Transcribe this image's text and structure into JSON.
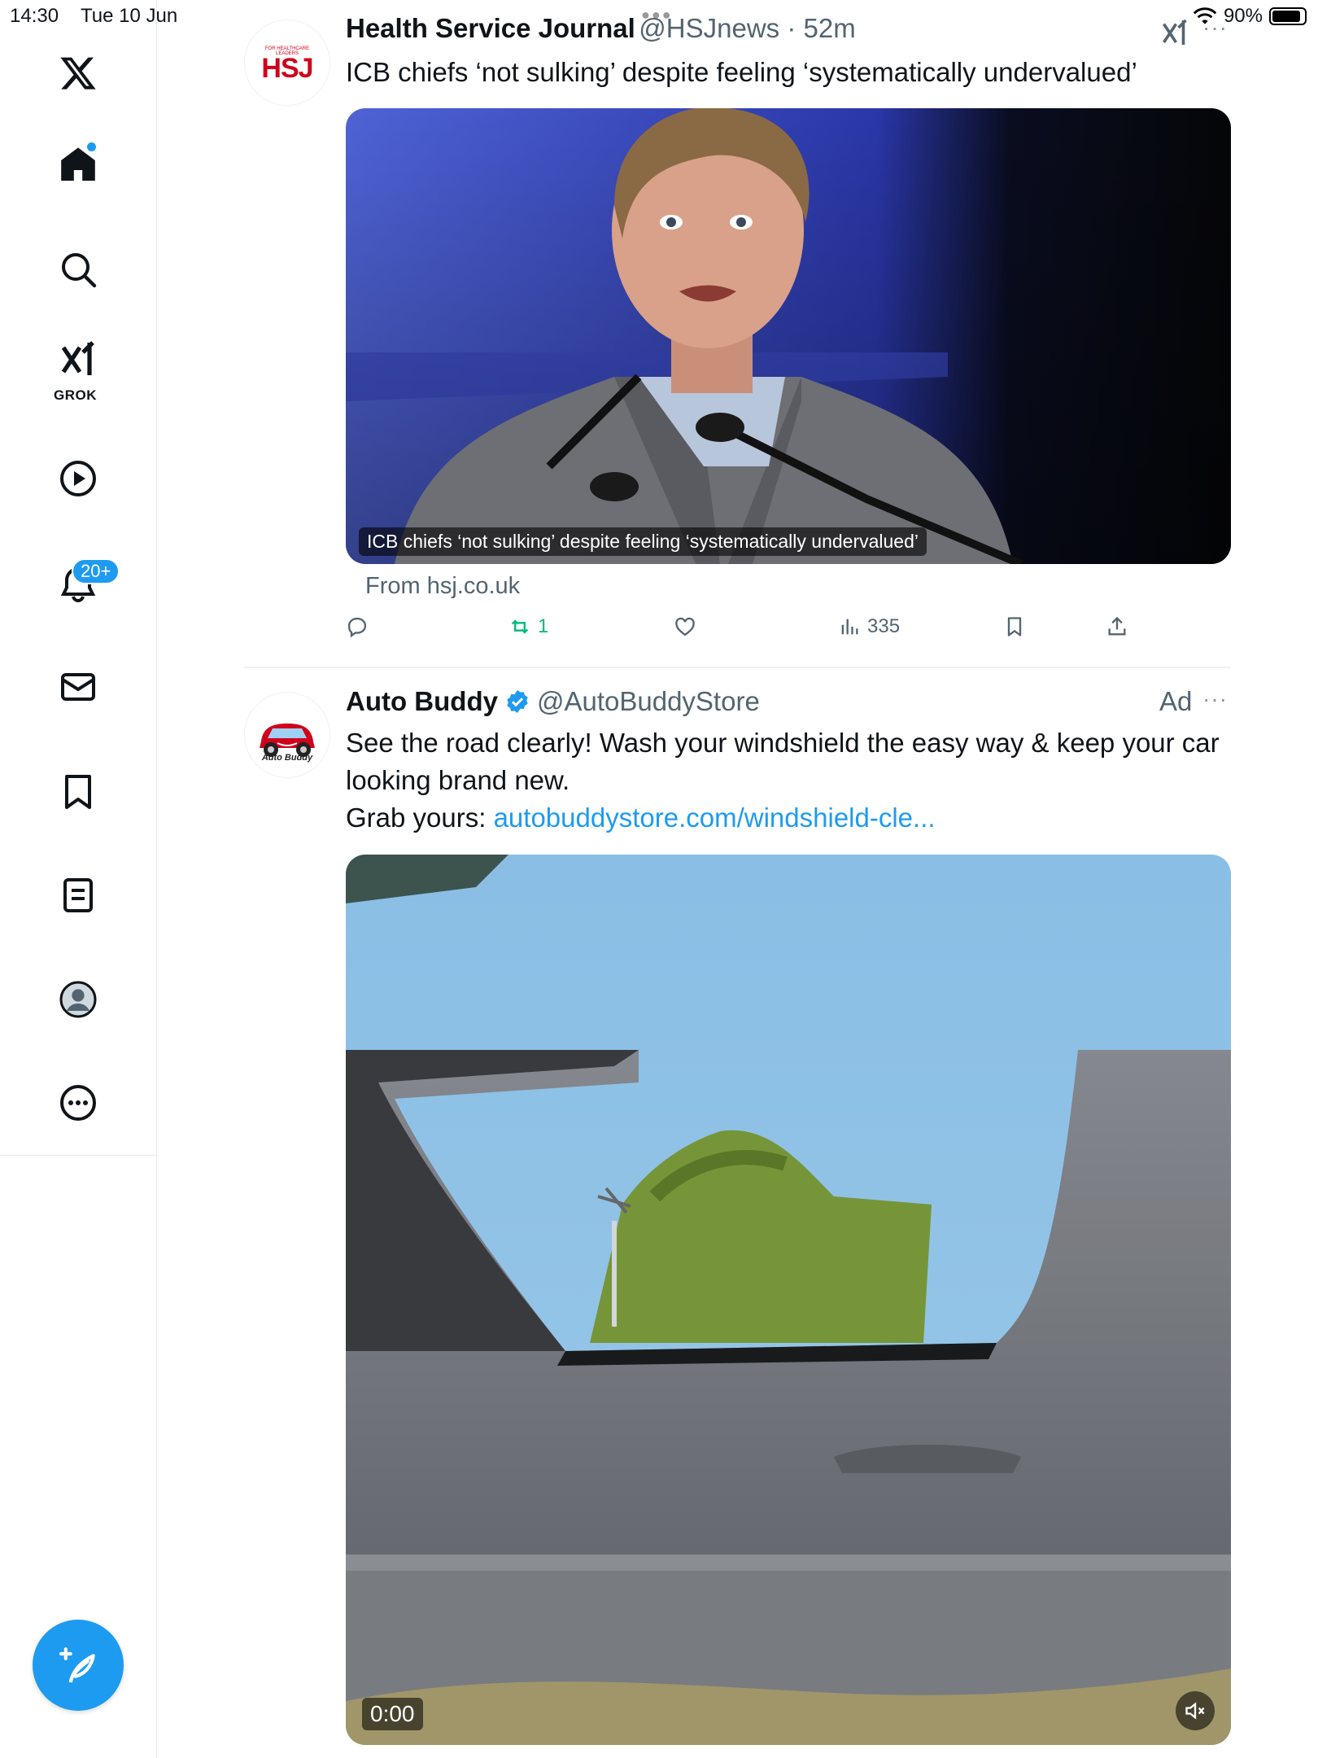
{
  "status_bar": {
    "time": "14:30",
    "date": "Tue 10 Jun",
    "battery": "90%",
    "battery_level": 0.9
  },
  "sidebar": {
    "items": [
      {
        "name": "home",
        "icon": "home-icon"
      },
      {
        "name": "explore",
        "icon": "search-icon"
      },
      {
        "name": "grok",
        "icon": "grok-icon",
        "label": "GROK"
      },
      {
        "name": "videos",
        "icon": "play-icon"
      },
      {
        "name": "notifications",
        "icon": "bell-icon",
        "badge": "20+"
      },
      {
        "name": "messages",
        "icon": "mail-icon"
      },
      {
        "name": "bookmarks",
        "icon": "bookmark-icon"
      },
      {
        "name": "lists",
        "icon": "list-icon"
      },
      {
        "name": "profile",
        "icon": "avatar-icon"
      },
      {
        "name": "more",
        "icon": "more-icon"
      }
    ]
  },
  "tweets": [
    {
      "author": "Health Service Journal",
      "handle": "@HSJnews",
      "time": "52m",
      "avatar_text": "HSJ",
      "avatar_tagline": "FOR HEALTHCARE LEADERS",
      "text": "ICB chiefs ‘not sulking’ despite feeling ‘systematically undervalued’",
      "card_caption": "ICB chiefs ‘not sulking’ despite feeling ‘systematically undervalued’",
      "card_source": "From hsj.co.uk",
      "actions": {
        "reply": "",
        "retweet": "1",
        "like": "",
        "views": "335"
      }
    },
    {
      "author": "Auto Buddy",
      "handle": "@AutoBuddyStore",
      "ad_label": "Ad",
      "avatar_text": "Auto Buddy",
      "text": "See the road clearly! Wash your windshield the easy way & keep your car looking brand new.",
      "grab_prefix": "Grab yours: ",
      "link": "autobuddystore.com/windshield-cle...",
      "video_time": "0:00"
    }
  ],
  "colors": {
    "accent": "#1d9bf0",
    "retweet": "#00ba7c",
    "hsj_red": "#d0021b"
  }
}
